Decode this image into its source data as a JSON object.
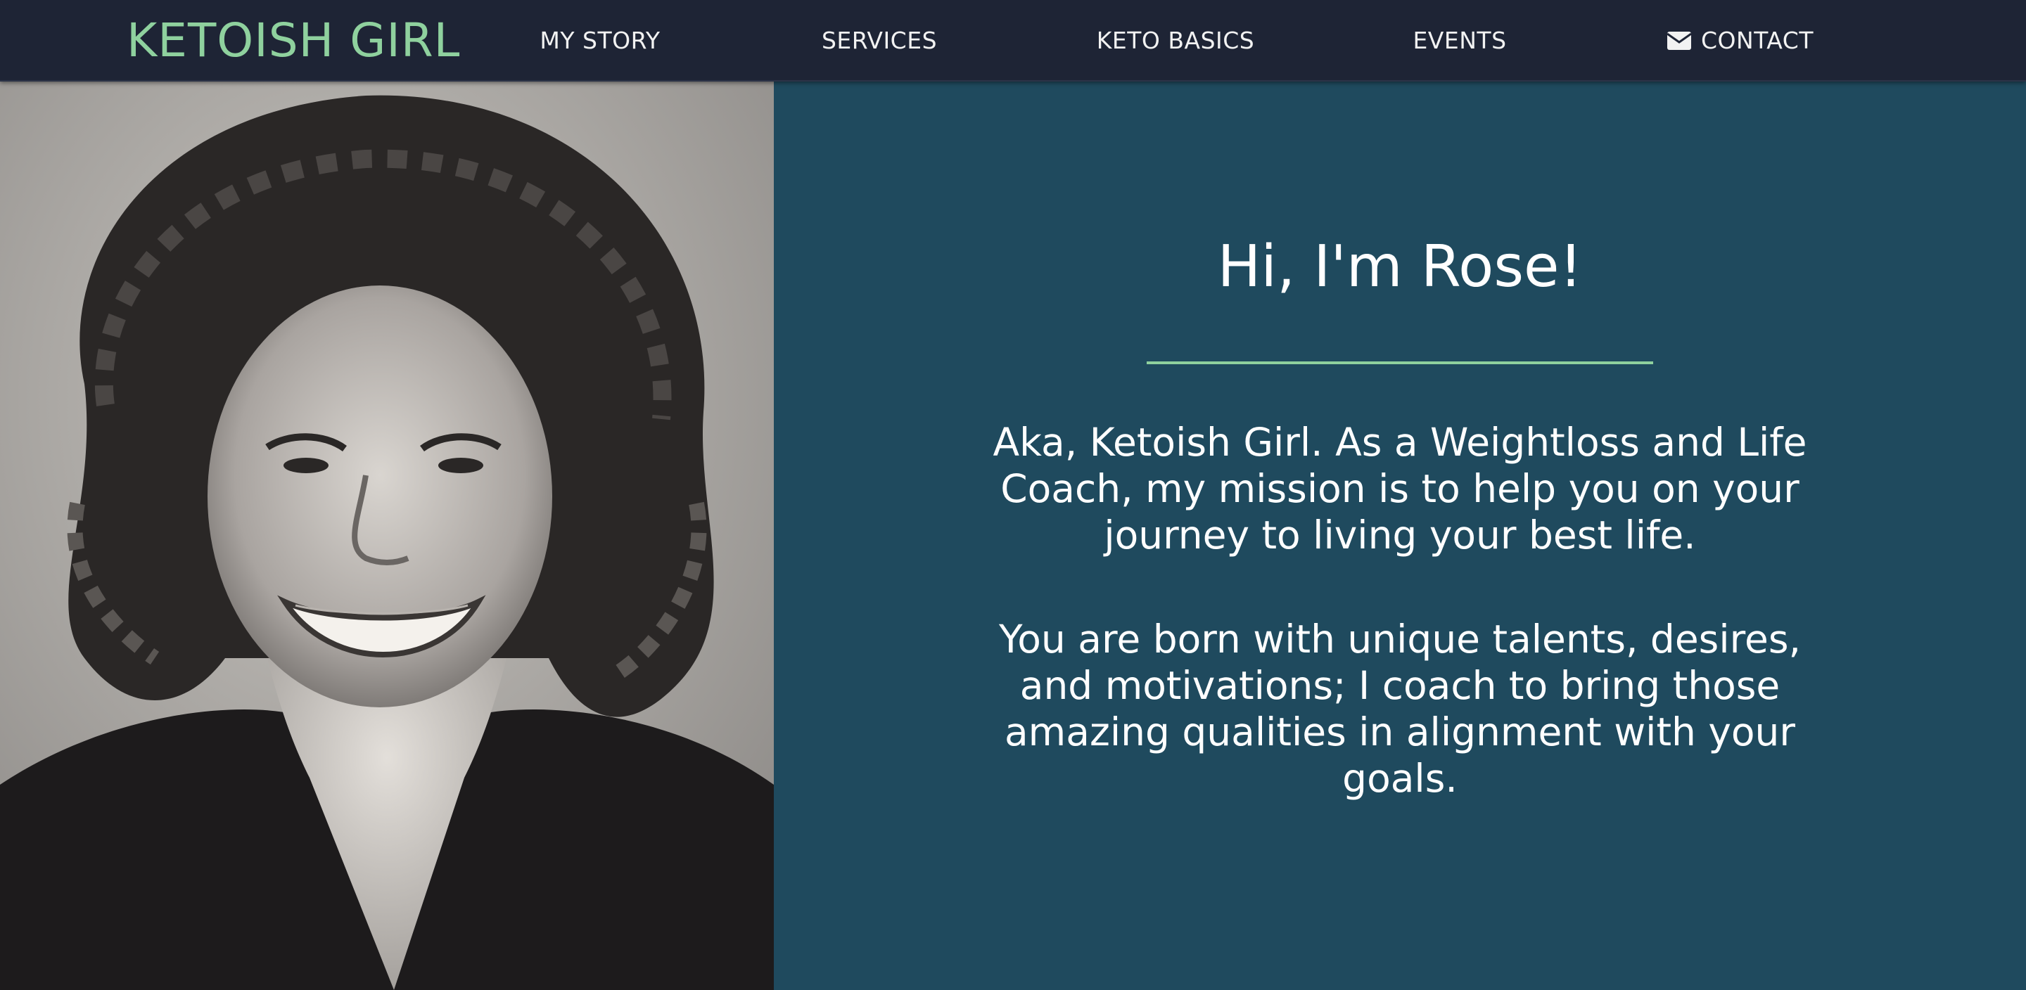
{
  "navbar": {
    "brand": "KETOISH GIRL",
    "items": [
      {
        "label": "MY STORY"
      },
      {
        "label": "SERVICES"
      },
      {
        "label": "KETO BASICS"
      },
      {
        "label": "EVENTS"
      },
      {
        "label": "CONTACT",
        "icon": "envelope-icon"
      }
    ]
  },
  "hero": {
    "photo_icon": "portrait-photo",
    "heading": "Hi, I'm Rose!",
    "paragraphs": [
      "Aka, Ketoish Girl. As a Weightloss and Life Coach, my mission is to help you on your journey to living your best life.",
      "You are born with unique talents, desires, and motivations; I coach to bring those amazing qualities in alignment with your goals."
    ]
  },
  "colors": {
    "navbar_bg": "#1e2435",
    "brand": "#8fd19e",
    "content_bg": "#1f4a5e",
    "divider": "#8fd19e",
    "text": "#ffffff"
  }
}
